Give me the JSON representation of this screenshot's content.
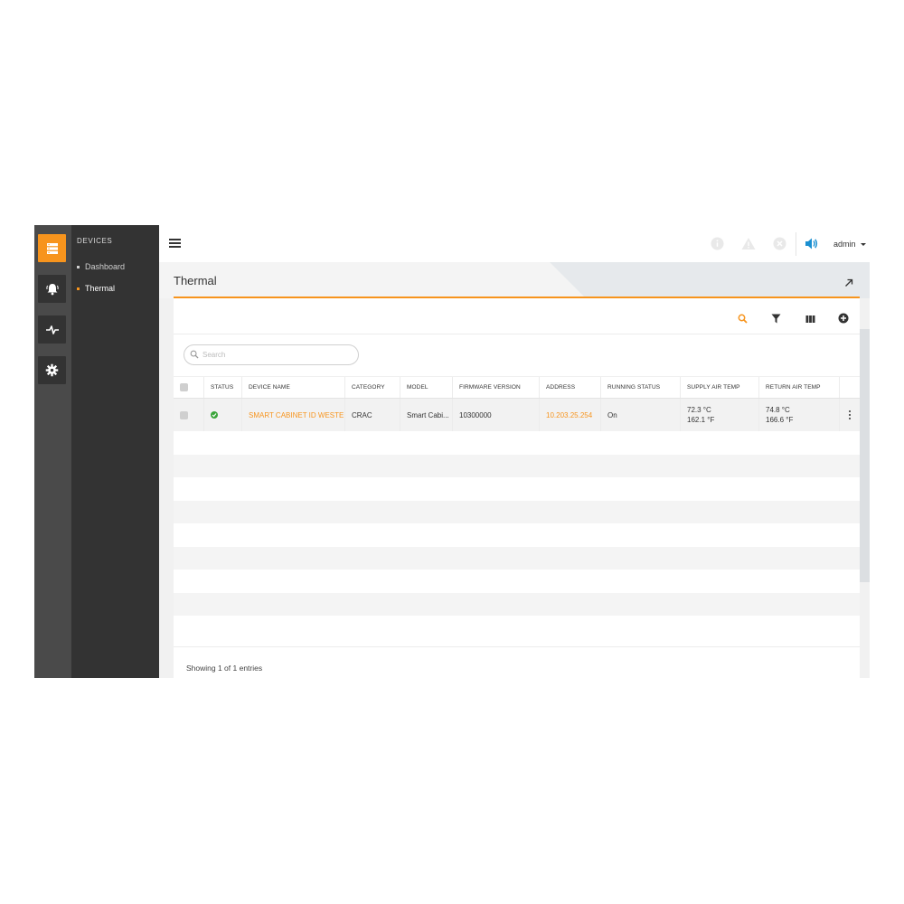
{
  "nav": {
    "section_title": "DEVICES",
    "items": [
      {
        "label": "Dashboard",
        "active": false
      },
      {
        "label": "Thermal",
        "active": true
      }
    ],
    "rail_icons": [
      "devices-icon",
      "alarm-bell-icon",
      "pulse-icon",
      "gear-icon"
    ]
  },
  "header": {
    "user_label": "admin",
    "icons": [
      "info-icon",
      "warning-icon",
      "error-icon",
      "speaker-icon"
    ]
  },
  "page": {
    "title": "Thermal"
  },
  "toolbar": {
    "icons": [
      "search-icon",
      "filter-icon",
      "columns-icon",
      "add-icon"
    ]
  },
  "search": {
    "placeholder": "Search"
  },
  "table": {
    "columns": [
      "STATUS",
      "DEVICE NAME",
      "CATEGORY",
      "MODEL",
      "FIRMWARE VERSION",
      "ADDRESS",
      "RUNNING STATUS",
      "SUPPLY AIR TEMP",
      "RETURN AIR TEMP"
    ],
    "rows": [
      {
        "status": "ok",
        "device_name": "SMART CABINET ID WESTE...",
        "category": "CRAC",
        "model": "Smart Cabi...",
        "firmware_version": "10300000",
        "address": "10.203.25.254",
        "running_status": "On",
        "supply_air_temp_c": "72.3 °C",
        "supply_air_temp_f": "162.1 °F",
        "return_air_temp_c": "74.8 °C",
        "return_air_temp_f": "166.6 °F"
      }
    ]
  },
  "footer": {
    "entries_text": "Showing 1 of 1 entries"
  },
  "colors": {
    "accent": "#f7941d",
    "status_ok": "#3aa53a",
    "speaker": "#1a8fd1"
  }
}
